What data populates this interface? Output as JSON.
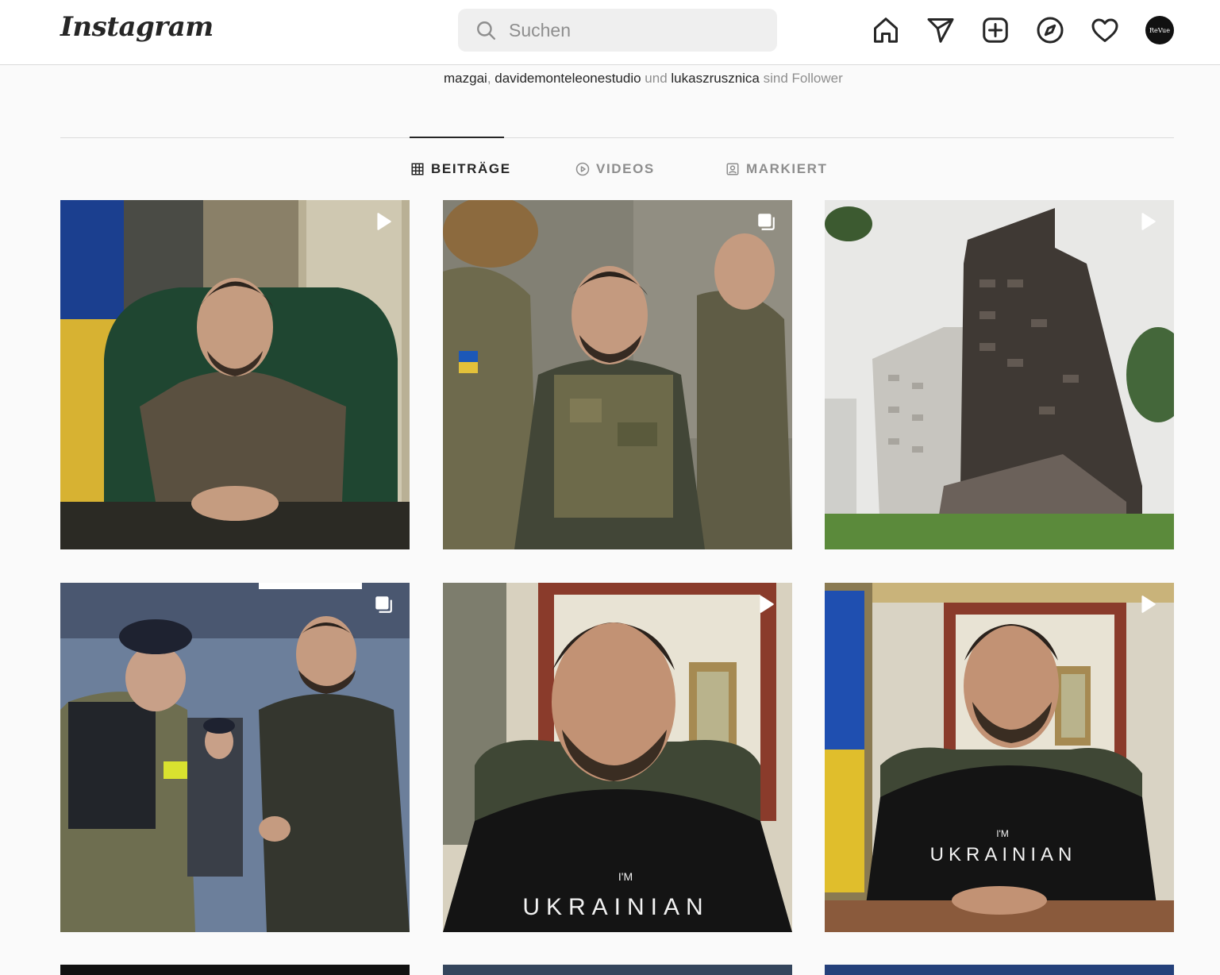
{
  "app": {
    "logo_text": "Instagram"
  },
  "search": {
    "placeholder": "Suchen"
  },
  "nav": {
    "icons": [
      "home-icon",
      "direct-message-icon",
      "new-post-icon",
      "explore-icon",
      "activity-heart-icon"
    ],
    "avatar_text": "ReVue"
  },
  "followers": {
    "user1": "mazgai",
    "sep1": ", ",
    "user2": "davidemonteleonestudio",
    "and": " und ",
    "user3": "lukaszrusznica",
    "suffix": " sind Follower"
  },
  "tabs": [
    {
      "label": "BEITRÄGE",
      "icon": "grid-icon",
      "active": true
    },
    {
      "label": "VIDEOS",
      "icon": "play-circle-icon",
      "active": false
    },
    {
      "label": "MARKIERT",
      "icon": "tagged-user-icon",
      "active": false
    }
  ],
  "posts": [
    {
      "badge": "reel-icon",
      "scene": "man seated at desk in green armchair"
    },
    {
      "badge": "carousel-icon",
      "scene": "man in military vest among soldiers"
    },
    {
      "badge": "reel-icon",
      "scene": "destroyed apartment building"
    },
    {
      "badge": "carousel-icon",
      "scene": "handshake with soldier at ceremony"
    },
    {
      "badge": "reel-icon",
      "scene": "man in black t-shirt video address"
    },
    {
      "badge": "reel-icon",
      "scene": "man in black t-shirt at desk with flag"
    }
  ],
  "shirt_text": {
    "small": "I'M",
    "large": "UKRAINIAN"
  },
  "colors": {
    "text": "#262626",
    "secondary": "#8e8e8e",
    "border": "#dbdbdb",
    "background": "#fafafa",
    "search_bg": "#efefef"
  }
}
